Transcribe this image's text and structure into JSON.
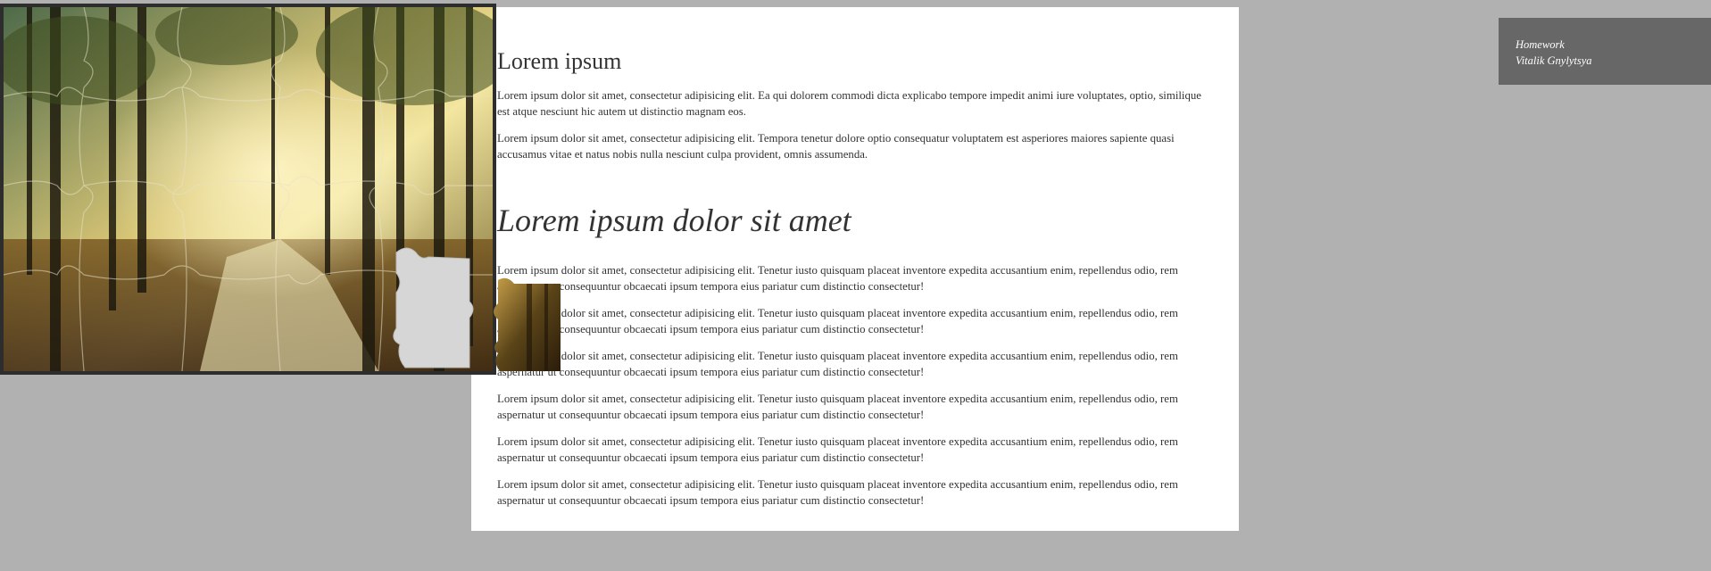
{
  "article": {
    "heading1": "Lorem ipsum",
    "intro": [
      "Lorem ipsum dolor sit amet, consectetur adipisicing elit. Ea qui dolorem commodi dicta explicabo tempore impedit animi iure voluptates, optio, similique est atque nesciunt hic autem ut distinctio magnam eos.",
      "Lorem ipsum dolor sit amet, consectetur adipisicing elit. Tempora tenetur dolore optio consequatur voluptatem est asperiores maiores sapiente quasi accusamus vitae et natus nobis nulla nesciunt culpa provident, omnis assumenda."
    ],
    "heading2": "Lorem ipsum dolor sit amet",
    "body": [
      "Lorem ipsum dolor sit amet, consectetur adipisicing elit. Tenetur iusto quisquam placeat inventore expedita accusantium enim, repellendus odio, rem aspernatur ut consequuntur obcaecati ipsum tempora eius pariatur cum distinctio consectetur!",
      "Lorem ipsum dolor sit amet, consectetur adipisicing elit. Tenetur iusto quisquam placeat inventore expedita accusantium enim, repellendus odio, rem aspernatur ut consequuntur obcaecati ipsum tempora eius pariatur cum distinctio consectetur!",
      "Lorem ipsum dolor sit amet, consectetur adipisicing elit. Tenetur iusto quisquam placeat inventore expedita accusantium enim, repellendus odio, rem aspernatur ut consequuntur obcaecati ipsum tempora eius pariatur cum distinctio consectetur!",
      "Lorem ipsum dolor sit amet, consectetur adipisicing elit. Tenetur iusto quisquam placeat inventore expedita accusantium enim, repellendus odio, rem aspernatur ut consequuntur obcaecati ipsum tempora eius pariatur cum distinctio consectetur!",
      "Lorem ipsum dolor sit amet, consectetur adipisicing elit. Tenetur iusto quisquam placeat inventore expedita accusantium enim, repellendus odio, rem aspernatur ut consequuntur obcaecati ipsum tempora eius pariatur cum distinctio consectetur!",
      "Lorem ipsum dolor sit amet, consectetur adipisicing elit. Tenetur iusto quisquam placeat inventore expedita accusantium enim, repellendus odio, rem aspernatur ut consequuntur obcaecati ipsum tempora eius pariatur cum distinctio consectetur!"
    ]
  },
  "badge": {
    "line1": "Homework",
    "line2": "Vitalik Gnylytsya"
  },
  "puzzle": {
    "image": "forest-sunlight-puzzle",
    "colors": {
      "frame": "#2d2d2d",
      "light": "#f2e6a0",
      "foliage": "#6b6a2a",
      "ground": "#5a3a14"
    }
  },
  "colors": {
    "page_bg": "#b1b1b1",
    "card_bg": "#ffffff",
    "badge_bg": "#676767",
    "text": "#333333"
  }
}
